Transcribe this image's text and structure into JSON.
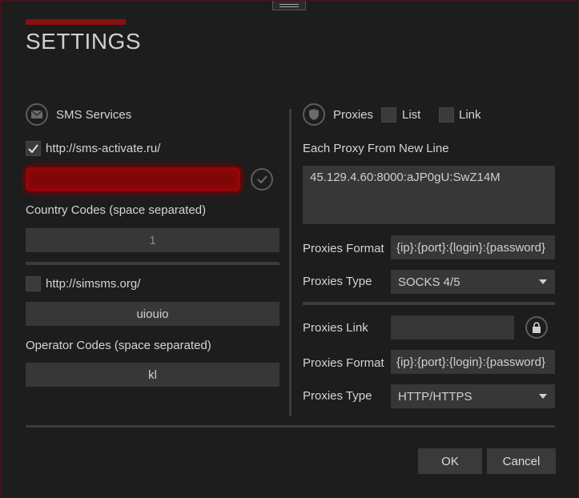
{
  "window": {
    "title": "SETTINGS"
  },
  "sms": {
    "section_label": "SMS Services",
    "service1": {
      "url": "http://sms-activate.ru/",
      "checked": true
    },
    "country_codes_label": "Country Codes (space separated)",
    "country_codes_placeholder": "1",
    "service2": {
      "url": "http://simsms.org/",
      "checked": false,
      "key_value": "uiouio"
    },
    "operator_codes_label": "Operator Codes (space separated)",
    "operator_codes_value": "kl"
  },
  "proxies": {
    "section_label": "Proxies",
    "list_label": "List",
    "link_label": "Link",
    "each_proxy_label": "Each Proxy From New Line",
    "proxy_list_value": "45.129.4.60:8000:aJP0gU:SwZ14M",
    "list_format_label": "Proxies Format",
    "list_format_value": "{ip}:{port}:{login}:{password}",
    "list_type_label": "Proxies Type",
    "list_type_value": "SOCKS 4/5",
    "link_label_field": "Proxies Link",
    "link_value": "",
    "link_format_label": "Proxies Format",
    "link_format_value": "{ip}:{port}:{login}:{password}",
    "link_type_label": "Proxies Type",
    "link_type_value": "HTTP/HTTPS"
  },
  "footer": {
    "ok_label": "OK",
    "cancel_label": "Cancel"
  },
  "colors": {
    "accent": "#8a0f10",
    "background": "#1d1d1d",
    "field": "#373737"
  }
}
